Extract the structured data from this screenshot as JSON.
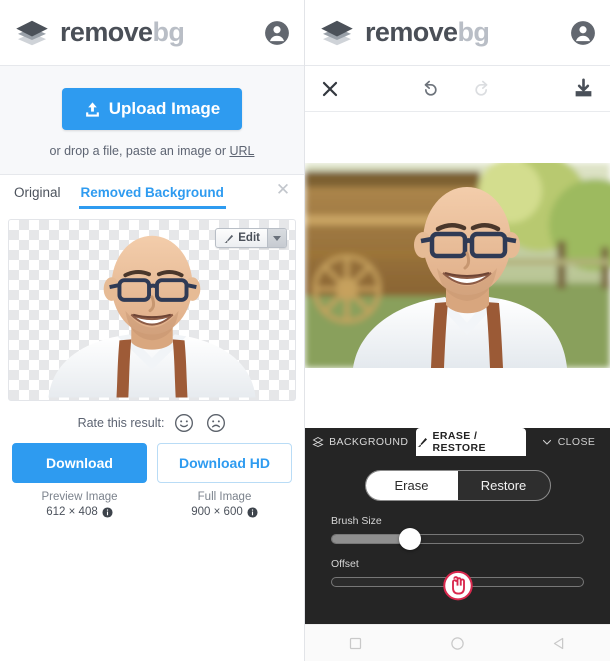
{
  "brand": {
    "name_primary": "remove",
    "name_secondary": "bg",
    "logo_icon": "layers-icon",
    "account_icon": "account-circle-icon"
  },
  "left_panel": {
    "upload": {
      "button_label": "Upload Image",
      "button_icon": "upload-icon",
      "hint_prefix": "or drop a file, paste an image or ",
      "hint_link": "URL"
    },
    "tabs": [
      {
        "label": "Original",
        "active": false
      },
      {
        "label": "Removed Background",
        "active": true
      }
    ],
    "close_icon": "close-icon",
    "edit_button": {
      "label": "Edit",
      "icon": "brush-icon",
      "caret_icon": "caret-down-icon"
    },
    "rate": {
      "label": "Rate this result:",
      "happy_icon": "smiley-happy-icon",
      "sad_icon": "smiley-sad-icon"
    },
    "downloads": [
      {
        "button_label": "Download",
        "caption": "Preview Image",
        "dimensions": "612 × 408",
        "info_icon": "info-icon",
        "style": "primary"
      },
      {
        "button_label": "Download HD",
        "caption": "Full Image",
        "dimensions": "900 × 600",
        "info_icon": "info-icon",
        "style": "secondary"
      }
    ]
  },
  "right_panel": {
    "toolbar": {
      "close_icon": "close-icon",
      "undo_icon": "undo-icon",
      "redo_icon": "redo-icon",
      "download_icon": "download-icon",
      "redo_disabled": true
    },
    "editor": {
      "tabs": [
        {
          "label": "BACKGROUND",
          "icon": "layers-icon",
          "active": false
        },
        {
          "label": "ERASE / RESTORE",
          "icon": "brush-icon",
          "active": true
        },
        {
          "label": "CLOSE",
          "icon": "chevron-down-icon",
          "active": false
        }
      ],
      "mode_toggle": [
        {
          "label": "Erase",
          "active": true
        },
        {
          "label": "Restore",
          "active": false
        }
      ],
      "sliders": [
        {
          "label": "Brush Size",
          "value_pct": 31
        },
        {
          "label": "Offset",
          "value_pct": 50
        }
      ],
      "cursor_icon": "hand-pointer-cursor"
    }
  },
  "android_nav": {
    "items": [
      {
        "icon": "recent-apps-icon"
      },
      {
        "icon": "home-icon"
      },
      {
        "icon": "back-icon"
      }
    ]
  },
  "colors": {
    "accent_blue": "#2e9bf0",
    "brand_dark": "#4a4f57",
    "brand_light": "#b9bec6",
    "editor_dark": "#252525"
  }
}
